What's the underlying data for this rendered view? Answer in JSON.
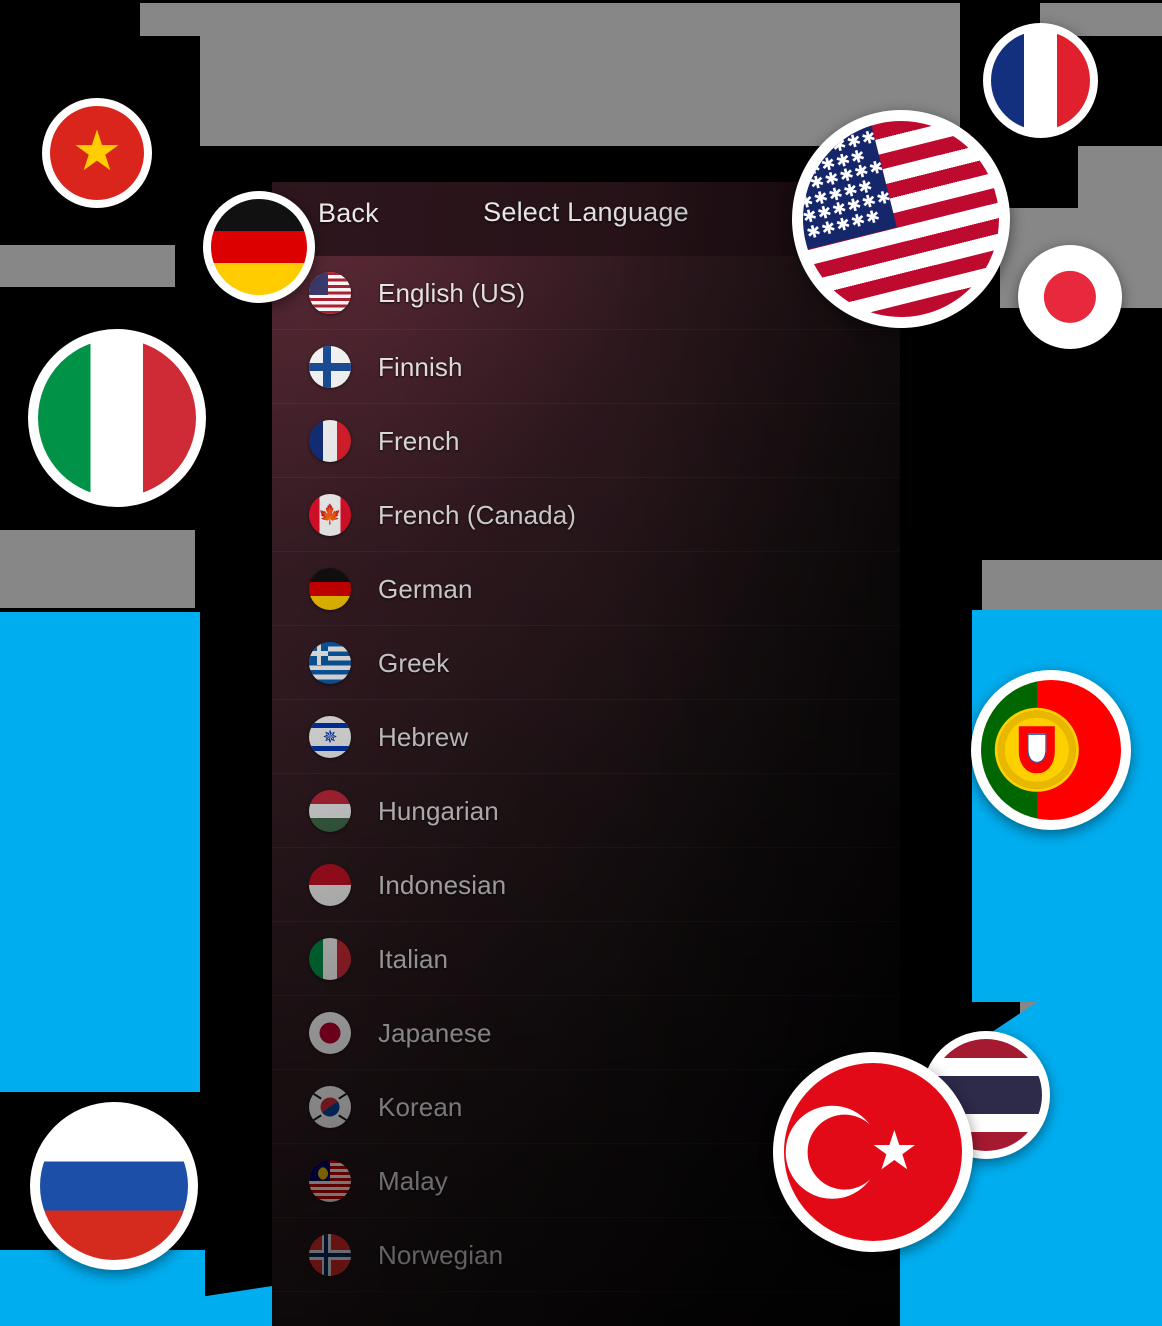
{
  "screen": {
    "app_kind": "mobile-language-picker",
    "colors": {
      "accent_cyan": "#00AEF0",
      "gray_block": "#878787",
      "panel_tint": "#42242c",
      "text": "#f4f1f2"
    }
  },
  "navbar": {
    "back_label": "Back",
    "title": "Select Language"
  },
  "languages": [
    {
      "name": "English (US)",
      "flag": "us",
      "flag_name": "flag-us"
    },
    {
      "name": "Finnish",
      "flag": "fi",
      "flag_name": "flag-finland"
    },
    {
      "name": "French",
      "flag": "fr",
      "flag_name": "flag-france"
    },
    {
      "name": "French (Canada)",
      "flag": "ca",
      "flag_name": "flag-canada"
    },
    {
      "name": "German",
      "flag": "de",
      "flag_name": "flag-germany"
    },
    {
      "name": "Greek",
      "flag": "gr",
      "flag_name": "flag-greece"
    },
    {
      "name": "Hebrew",
      "flag": "il",
      "flag_name": "flag-israel"
    },
    {
      "name": "Hungarian",
      "flag": "hu",
      "flag_name": "flag-hungary"
    },
    {
      "name": "Indonesian",
      "flag": "id",
      "flag_name": "flag-indonesia"
    },
    {
      "name": "Italian",
      "flag": "it",
      "flag_name": "flag-italy"
    },
    {
      "name": "Japanese",
      "flag": "jp",
      "flag_name": "flag-japan"
    },
    {
      "name": "Korean",
      "flag": "kr",
      "flag_name": "flag-southkorea"
    },
    {
      "name": "Malay",
      "flag": "my",
      "flag_name": "flag-malaysia"
    },
    {
      "name": "Norwegian",
      "flag": "no",
      "flag_name": "flag-norway"
    }
  ],
  "floating_badges": [
    {
      "id": "vn",
      "country": "Vietnam"
    },
    {
      "id": "de",
      "country": "Germany"
    },
    {
      "id": "it",
      "country": "Italy"
    },
    {
      "id": "ru",
      "country": "Russia"
    },
    {
      "id": "us",
      "country": "United States"
    },
    {
      "id": "fr",
      "country": "France"
    },
    {
      "id": "jp",
      "country": "Japan"
    },
    {
      "id": "pt",
      "country": "Portugal"
    },
    {
      "id": "tr",
      "country": "Turkey"
    },
    {
      "id": "th",
      "country": "Thailand"
    }
  ]
}
